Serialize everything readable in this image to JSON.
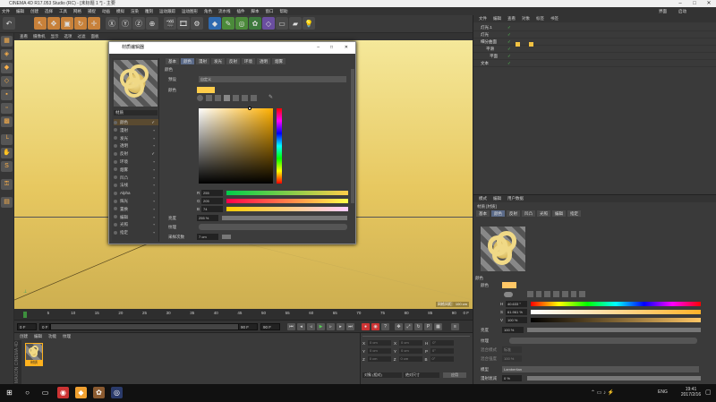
{
  "window": {
    "title": "CINEMA 4D R17.053 Studio (RC) - [未标题 1 *] - 主要"
  },
  "menubar": {
    "items": [
      "文件",
      "编辑",
      "创建",
      "选择",
      "工具",
      "网格",
      "捕捉",
      "动画",
      "模拟",
      "渲染",
      "雕刻",
      "运动跟踪",
      "运动图形",
      "角色",
      "流水线",
      "插件",
      "脚本",
      "窗口",
      "帮助"
    ],
    "right": [
      "界面",
      "启动"
    ]
  },
  "viewport": {
    "menu": [
      "查看",
      "摄像机",
      "显示",
      "选项",
      "过滤",
      "面板"
    ],
    "hud": "网格间距：100 cm"
  },
  "timeline": {
    "ticks": [
      "0",
      "5",
      "10",
      "15",
      "20",
      "25",
      "30",
      "35",
      "40",
      "45",
      "50",
      "55",
      "60",
      "65",
      "70",
      "75",
      "80",
      "85",
      "90"
    ],
    "end_label": "0 F",
    "start_field": "0 F",
    "cur_field": "0 F",
    "end_field": "90 F",
    "end_field2": "90 F"
  },
  "material_manager": {
    "menu": [
      "创建",
      "编辑",
      "功能",
      "纹理"
    ],
    "material_name": "材质",
    "brand": "MAXON CINEMA 4D"
  },
  "coordinates": {
    "rows": [
      {
        "axis": "X",
        "pos": "0 cm",
        "size": "0 cm",
        "rot": "H",
        "rot_val": "0°"
      },
      {
        "axis": "Y",
        "pos": "0 cm",
        "size": "0 cm",
        "rot": "P",
        "rot_val": "0°"
      },
      {
        "axis": "Z",
        "pos": "0 cm",
        "size": "0 cm",
        "rot": "B",
        "rot_val": "0°"
      }
    ],
    "mode1": "对象 (相对)",
    "mode2": "绝对尺寸",
    "apply": "应用"
  },
  "object_manager": {
    "menu": [
      "文件",
      "编辑",
      "查看",
      "对象",
      "标签",
      "书签"
    ],
    "objects": [
      {
        "name": "灯光.1"
      },
      {
        "name": "灯光"
      },
      {
        "name": "细分曲面"
      },
      {
        "name": "平滑"
      },
      {
        "name": "平面"
      },
      {
        "name": "文本"
      }
    ]
  },
  "attributes": {
    "menu": [
      "模式",
      "编辑",
      "用户数据"
    ],
    "material_label": "材质 [材质]",
    "tabs": [
      "基本",
      "颜色",
      "反射",
      "凹凸",
      "光照",
      "编辑",
      "指定"
    ],
    "active_tab": "颜色",
    "section": "颜色",
    "color_label": "颜色",
    "h_label": "H",
    "h_value": "40.633 °",
    "s_label": "S",
    "s_value": "61.961 %",
    "v_label": "V",
    "v_value": "100 %",
    "brightness_label": "亮度",
    "brightness_value": "100 %",
    "texture_label": "纹理",
    "mix_mode_label": "混合模式",
    "mix_mode_value": "标准",
    "mix_strength_label": "混合强度",
    "mix_strength_value": "100 %",
    "model_label": "模型",
    "model_value": "Lambertian",
    "diffuse_label": "漫射衰减",
    "diffuse_value": "0 %",
    "swatch_color": "#ffc766"
  },
  "material_editor": {
    "title": "材质编辑器",
    "name": "材质",
    "channels": [
      {
        "name": "颜色",
        "checked": true
      },
      {
        "name": "漫射",
        "checked": false
      },
      {
        "name": "发光",
        "checked": false
      },
      {
        "name": "透明",
        "checked": false
      },
      {
        "name": "反射",
        "checked": true
      },
      {
        "name": "环境",
        "checked": false
      },
      {
        "name": "烟雾",
        "checked": false
      },
      {
        "name": "凹凸",
        "checked": false
      },
      {
        "name": "法线",
        "checked": false
      },
      {
        "name": "Alpha",
        "checked": false
      },
      {
        "name": "辉光",
        "checked": false
      },
      {
        "name": "置换",
        "checked": false
      },
      {
        "name": "编辑",
        "checked": false
      },
      {
        "name": "光照",
        "checked": false
      },
      {
        "name": "指定",
        "checked": false
      }
    ],
    "tabs": [
      "基本",
      "颜色",
      "漫射",
      "发光",
      "反射",
      "环境",
      "透明",
      "烟雾"
    ],
    "active_tab": "颜色",
    "section_label": "颜色",
    "preset_label": "预设",
    "preset_value": "自定义",
    "color_label": "颜色",
    "r_label": "R",
    "r_value": "255",
    "g_label": "G",
    "g_value": "205",
    "b_label": "B",
    "b_value": "74",
    "brightness_label": "亮度",
    "brightness_value": "255 %",
    "texture_label": "纹理",
    "sample_label": "采样次数",
    "sample_value": "7 cm",
    "swatch_color": "#ffcd4a"
  },
  "taskbar": {
    "time": "19:41",
    "date": "2017/2/16",
    "lang": "ENG"
  }
}
